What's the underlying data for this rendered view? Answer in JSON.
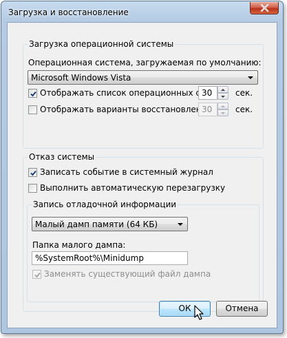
{
  "window": {
    "title": "Загрузка и восстановление",
    "close_icon": "close-icon"
  },
  "os_boot": {
    "group_label": "Загрузка операционной системы",
    "default_os_label": "Операционная система, загружаемая по умолчанию:",
    "default_os_value": "Microsoft Windows Vista",
    "show_os_list": {
      "label": "Отображать список операционных систем:",
      "checked": true,
      "value": "30",
      "unit": "сек."
    },
    "show_recovery": {
      "label": "Отображать варианты восстановления:",
      "checked": false,
      "value": "30",
      "unit": "сек."
    }
  },
  "system_failure": {
    "group_label": "Отказ системы",
    "write_event": {
      "label": "Записать событие в системный журнал",
      "checked": true
    },
    "auto_restart": {
      "label": "Выполнить автоматическую перезагрузку",
      "checked": false
    },
    "debug_info": {
      "group_label": "Запись отладочной информации",
      "dump_type_value": "Малый дамп памяти (64 КБ)",
      "folder_label": "Папка малого дампа:",
      "folder_value": "%SystemRoot%\\Minidump",
      "overwrite": {
        "label": "Заменять существующий файл дампа",
        "checked": true,
        "disabled": true
      }
    }
  },
  "buttons": {
    "ok": "ОК",
    "cancel": "Отмена"
  },
  "colors": {
    "title_bar": "#b4cbe3",
    "close_button": "#c7442a",
    "dialog_bg": "#f0f0f0",
    "default_button": "#bee6fd"
  }
}
